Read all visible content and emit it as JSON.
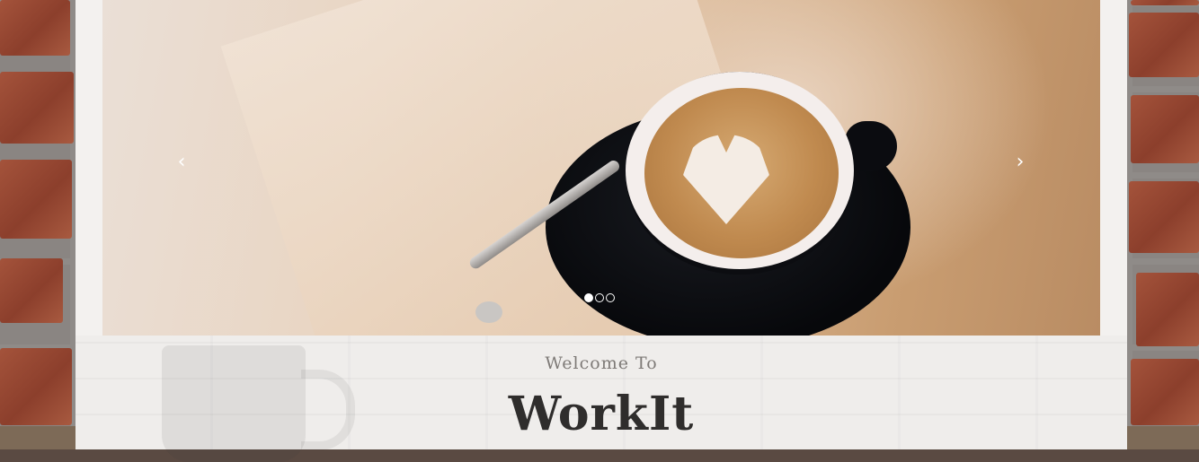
{
  "carousel": {
    "prev_arrow": "‹",
    "next_arrow": "›",
    "slide_count": 3,
    "active_slide": 1
  },
  "hero": {
    "welcome_text": "Welcome To",
    "brand_name": "WorkIt"
  },
  "colors": {
    "panel": "#f3f1ef",
    "brick": "#a4533b",
    "brand_text": "#2f2d2c",
    "welcome_text": "#7e7a77"
  }
}
